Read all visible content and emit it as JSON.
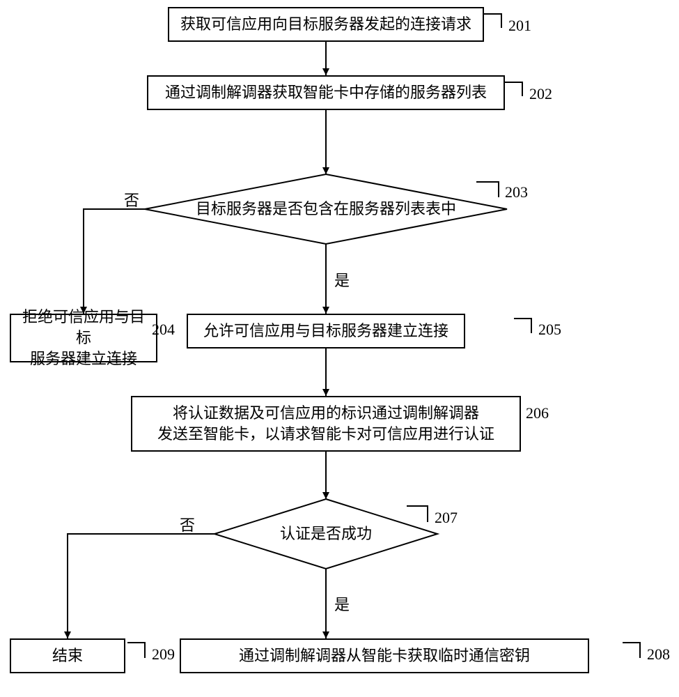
{
  "nodes": {
    "n201": {
      "text": "获取可信应用向目标服务器发起的连接请求",
      "label": "201"
    },
    "n202": {
      "text": "通过调制解调器获取智能卡中存储的服务器列表",
      "label": "202"
    },
    "n203": {
      "text": "目标服务器是否包含在服务器列表表中",
      "label": "203"
    },
    "n204": {
      "text": "拒绝可信应用与目标\n服务器建立连接",
      "label": "204"
    },
    "n205": {
      "text": "允许可信应用与目标服务器建立连接",
      "label": "205"
    },
    "n206": {
      "text": "将认证数据及可信应用的标识通过调制解调器\n发送至智能卡，以请求智能卡对可信应用进行认证",
      "label": "206"
    },
    "n207": {
      "text": "认证是否成功",
      "label": "207"
    },
    "n208": {
      "text": "通过调制解调器从智能卡获取临时通信密钥",
      "label": "208"
    },
    "n209": {
      "text": "结束",
      "label": "209"
    }
  },
  "edges": {
    "e203no": "否",
    "e203yes": "是",
    "e207no": "否",
    "e207yes": "是"
  },
  "chart_data": {
    "type": "flowchart",
    "title": "",
    "nodes": [
      {
        "id": "201",
        "shape": "process",
        "text": "获取可信应用向目标服务器发起的连接请求"
      },
      {
        "id": "202",
        "shape": "process",
        "text": "通过调制解调器获取智能卡中存储的服务器列表"
      },
      {
        "id": "203",
        "shape": "decision",
        "text": "目标服务器是否包含在服务器列表表中"
      },
      {
        "id": "204",
        "shape": "process",
        "text": "拒绝可信应用与目标服务器建立连接"
      },
      {
        "id": "205",
        "shape": "process",
        "text": "允许可信应用与目标服务器建立连接"
      },
      {
        "id": "206",
        "shape": "process",
        "text": "将认证数据及可信应用的标识通过调制解调器发送至智能卡，以请求智能卡对可信应用进行认证"
      },
      {
        "id": "207",
        "shape": "decision",
        "text": "认证是否成功"
      },
      {
        "id": "208",
        "shape": "process",
        "text": "通过调制解调器从智能卡获取临时通信密钥"
      },
      {
        "id": "209",
        "shape": "terminator",
        "text": "结束"
      }
    ],
    "edges": [
      {
        "from": "201",
        "to": "202",
        "label": ""
      },
      {
        "from": "202",
        "to": "203",
        "label": ""
      },
      {
        "from": "203",
        "to": "204",
        "label": "否"
      },
      {
        "from": "203",
        "to": "205",
        "label": "是"
      },
      {
        "from": "205",
        "to": "206",
        "label": ""
      },
      {
        "from": "206",
        "to": "207",
        "label": ""
      },
      {
        "from": "207",
        "to": "209",
        "label": "否"
      },
      {
        "from": "207",
        "to": "208",
        "label": "是"
      }
    ]
  }
}
